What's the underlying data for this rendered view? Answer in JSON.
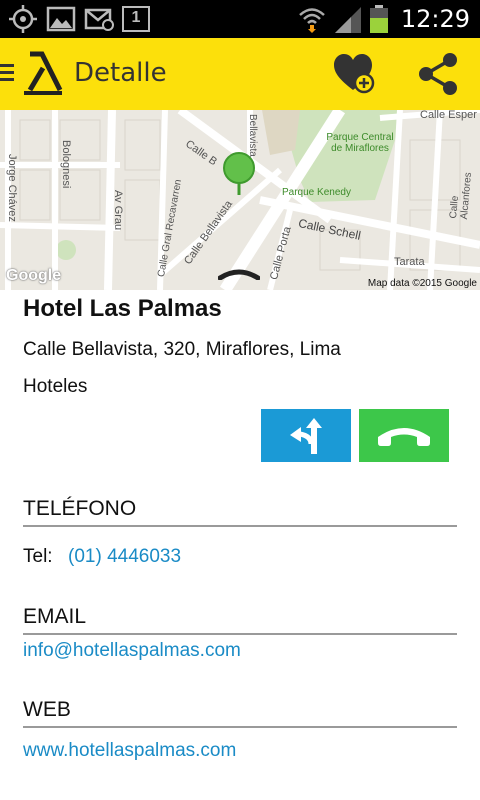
{
  "status_bar": {
    "time": "12:29",
    "calendar_day": "1",
    "icons": [
      "gps-icon",
      "gallery-icon",
      "email-notification-icon",
      "calendar-icon",
      "wifi-icon",
      "signal-icon",
      "battery-icon"
    ]
  },
  "app_bar": {
    "title": "Detalle",
    "background_color": "#fce00b"
  },
  "map": {
    "credit": "Map data ©2015 Google",
    "logo": "Google",
    "streets": [
      "Calle Bellavista",
      "Calle Schell",
      "Av Grau",
      "Bolognesi",
      "Jorge Chávez",
      "Calle Gral Recavarren",
      "Calle Porta",
      "Tarata",
      "Calle Alcanfores",
      "Calle Esper",
      "Bellavista",
      "Calle B"
    ],
    "places": [
      "Parque Central de Miraflores",
      "Parque Kenedy"
    ]
  },
  "place": {
    "name": "Hotel Las Palmas",
    "address": "Calle Bellavista, 320, Miraflores, Lima",
    "category": "Hoteles"
  },
  "actions": {
    "directions_color": "#1b9ad6",
    "call_color": "#3dc74a"
  },
  "sections": {
    "phone": {
      "header": "TELÉFONO",
      "label": "Tel:",
      "value": "(01) 4446033"
    },
    "email": {
      "header": "EMAIL",
      "value": "info@hotellaspalmas.com"
    },
    "web": {
      "header": "WEB",
      "value": "www.hotellaspalmas.com"
    }
  },
  "link_color": "#1a8bc6"
}
